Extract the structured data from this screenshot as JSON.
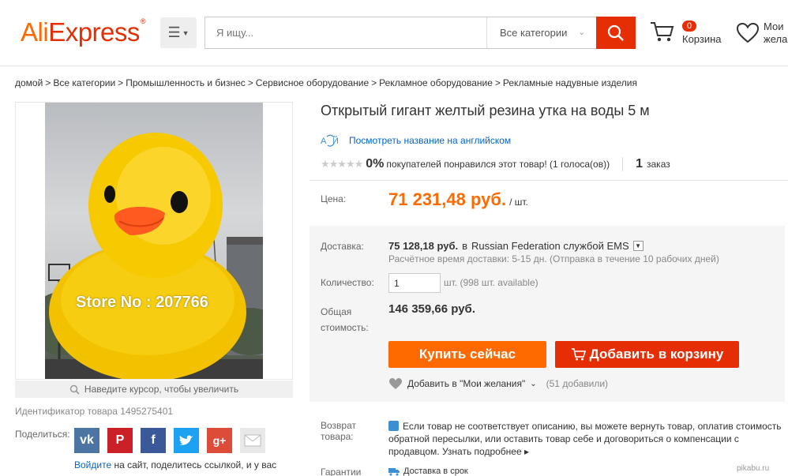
{
  "header": {
    "logo_part1": "Ali",
    "logo_part2": "Express",
    "search_placeholder": "Я ищу...",
    "category_select": "Все категории",
    "cart_count": "0",
    "cart_label": "Корзина",
    "wishlist_label": "Мои\nжела"
  },
  "breadcrumb": [
    "домой",
    "Все категории",
    "Промышленность и бизнес",
    "Сервисное оборудование",
    "Рекламное оборудование",
    "Рекламные надувные изделия"
  ],
  "gallery": {
    "watermark": "Store No : 207766",
    "zoom_hint": "Наведите курсор, чтобы увеличить"
  },
  "product_id": "Идентификатор товара 1495275401",
  "share": {
    "label": "Поделиться:",
    "networks": [
      "vk",
      "pinterest",
      "facebook",
      "twitter",
      "google-plus",
      "email"
    ],
    "login_link": "Войдите",
    "login_rest": " на сайт, поделитесь ссылкой, и у вас"
  },
  "product": {
    "title": "Открытый гигант желтый резина утка на воды 5 м",
    "translate_link": "Посмотреть название на английском",
    "rating_percent": "0%",
    "rating_desc": "покупателей понравился этот товар! (1 голоса(ов))",
    "orders_count": "1",
    "orders_label": "заказ",
    "price_label": "Цена:",
    "price": "71 231,48 руб.",
    "price_unit": "/ шт."
  },
  "purchase": {
    "shipping_label": "Доставка:",
    "shipping_price": "75 128,18 руб.",
    "shipping_dest": "в",
    "shipping_method": "Russian Federation службой EMS",
    "shipping_time": "Расчётное время доставки: 5-15 дн. (Отправка в течение 10 рабочих дней)",
    "qty_label": "Количество:",
    "qty_value": "1",
    "qty_available": "шт. (998 шт. available)",
    "total_label": "Общая стоимость:",
    "total_value": "146 359,66 руб.",
    "buy_now": "Купить сейчас",
    "add_to_cart": "Добавить в корзину",
    "wishlist_add": "Добавить в \"Мои желания\"",
    "wishlist_count": "(51 добавили)"
  },
  "returns": {
    "label": "Возврат товара:",
    "text": "Если товар не соответствует описанию, вы можете вернуть товар, оплатив стоимость обратной пересылки, или оставить товар себе и договориться о компенсации с продавцом. Узнать подробнее ▸",
    "guarantee_label": "Гарантии",
    "guarantee_text": "Доставка в срок"
  },
  "site_tag": "pikabu.ru",
  "colors": {
    "orange": "#ff6a00",
    "red": "#e62e04",
    "link": "#0066cc"
  }
}
